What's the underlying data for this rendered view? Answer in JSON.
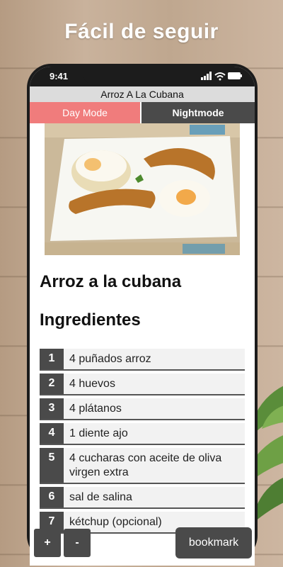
{
  "promo": {
    "headline": "Fácil de seguir"
  },
  "status": {
    "time": "9:41"
  },
  "app": {
    "title": "Arroz A La Cubana"
  },
  "modes": {
    "day": "Day Mode",
    "night": "Nightmode",
    "active_color": "#f07c7c",
    "inactive_color": "#4a4a4a"
  },
  "recipe": {
    "title": "Arroz a la cubana",
    "ingredients_heading": "Ingredientes",
    "ingredients": [
      {
        "n": "1",
        "text": "4 puñados arroz"
      },
      {
        "n": "2",
        "text": "4 huevos"
      },
      {
        "n": "3",
        "text": "4 plátanos"
      },
      {
        "n": "4",
        "text": "1 diente ajo"
      },
      {
        "n": "5",
        "text": "4 cucharas con aceite de oliva virgen extra"
      },
      {
        "n": "6",
        "text": "sal de salina"
      },
      {
        "n": "7",
        "text": "kétchup (opcional)"
      }
    ]
  },
  "controls": {
    "zoom_in": "+",
    "zoom_out": "-",
    "bookmark": "bookmark"
  }
}
